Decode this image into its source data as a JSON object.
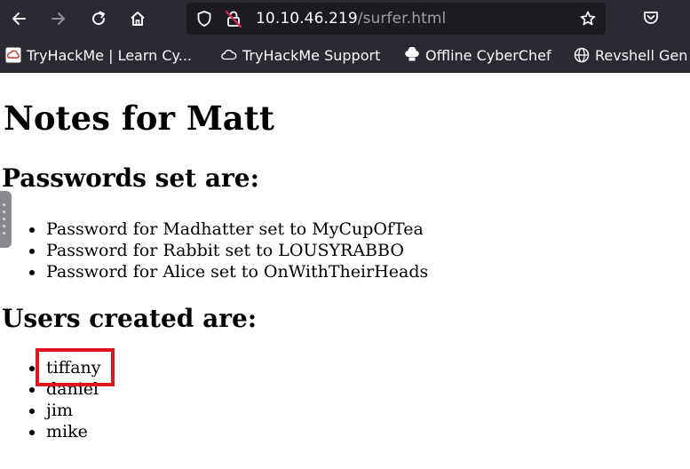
{
  "browser": {
    "url_host": "10.10.46.219",
    "url_path": "/surfer.html",
    "bookmarks": [
      {
        "label": "TryHackMe | Learn Cy...",
        "icon": "tryhackme-icon"
      },
      {
        "label": "TryHackMe Support",
        "icon": "cloud-icon"
      },
      {
        "label": "Offline CyberChef",
        "icon": "chef-hat-icon"
      },
      {
        "label": "Revshell Gen",
        "icon": "globe-icon"
      }
    ],
    "colors": {
      "toolbar": "#2b2a33",
      "urlbar": "#1c1b22",
      "highlight": "#e0141e"
    }
  },
  "page": {
    "title": "Notes for Matt",
    "passwords_heading": "Passwords set are:",
    "passwords": [
      "Password for Madhatter set to MyCupOfTea",
      "Password for Rabbit set to LOUSYRABBO",
      "Password for Alice set to OnWithTheirHeads"
    ],
    "users_heading": "Users created are:",
    "users": [
      "tiffany",
      "daniel",
      "jim",
      "mike"
    ]
  }
}
